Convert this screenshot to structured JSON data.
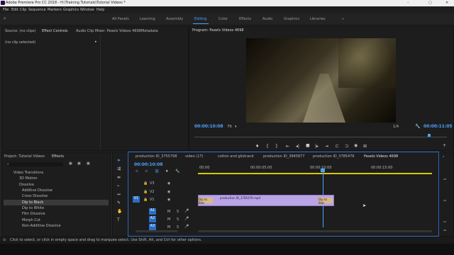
{
  "app_title": "Adobe Premiere Pro CC 2018 - H:\\Training Tutorials\\Tutorial Videos *",
  "window_controls": [
    "–",
    "▢",
    "✕"
  ],
  "menu": [
    "File",
    "Edit",
    "Clip",
    "Sequence",
    "Markers",
    "Graphics",
    "Window",
    "Help"
  ],
  "workspaces": [
    "All Panels",
    "Learning",
    "Assembly",
    "Editing",
    "Color",
    "Effects",
    "Audio",
    "Graphics",
    "Libraries"
  ],
  "workspace_more": "»",
  "source_panel": {
    "tabs": [
      "Source: (no clips)",
      "Effect Controls",
      "Audio Clip Mixer: Pexels Videos 4698",
      "Metadata"
    ],
    "empty_text": "(no clip selected)"
  },
  "program_panel": {
    "title": "Program: Pexels Videos 4698",
    "timecode": "00:00:10:08",
    "fit": "Fit",
    "ratio": "1/4",
    "duration": "00:00:11:05"
  },
  "project_panel": {
    "tabs": [
      "Project: Tutorial Videos",
      "Effects"
    ],
    "tree": [
      "Video Transitions",
      "3D Motion",
      "Dissolve",
      "Additive Dissolve",
      "Cross Dissolve",
      "Dip to Black",
      "Dip to White",
      "Film Dissolve",
      "Morph Cut",
      "Non-Additive Dissolve"
    ]
  },
  "timeline": {
    "tabs": [
      "production ID_3755798",
      "video (17)",
      "cotton and glistrand",
      "production ID_3845877",
      "production ID_3785476",
      "Pexels Videos 4698"
    ],
    "timecode": "00:00:10:08",
    "ruler": [
      "00:00",
      "00:00:05:00",
      "00:00:10:00",
      "00:00:15:00"
    ],
    "video_tracks": [
      "V3",
      "V2",
      "V1"
    ],
    "audio_tracks": [
      "A1",
      "A2",
      "A3"
    ],
    "track_letters": [
      "M",
      "S"
    ],
    "clip_name": "production ID_3785476.mp4",
    "transition_label": "Dip to Blac"
  },
  "meter_values": [
    "0",
    "-6",
    "-12",
    "-18",
    "-24",
    "-30",
    "-36",
    "-42",
    "-48",
    "-54",
    "dB"
  ],
  "status": "Click to select, or click in empty space and drag to marquee select. Use Shift, Alt, and Ctrl for other options."
}
